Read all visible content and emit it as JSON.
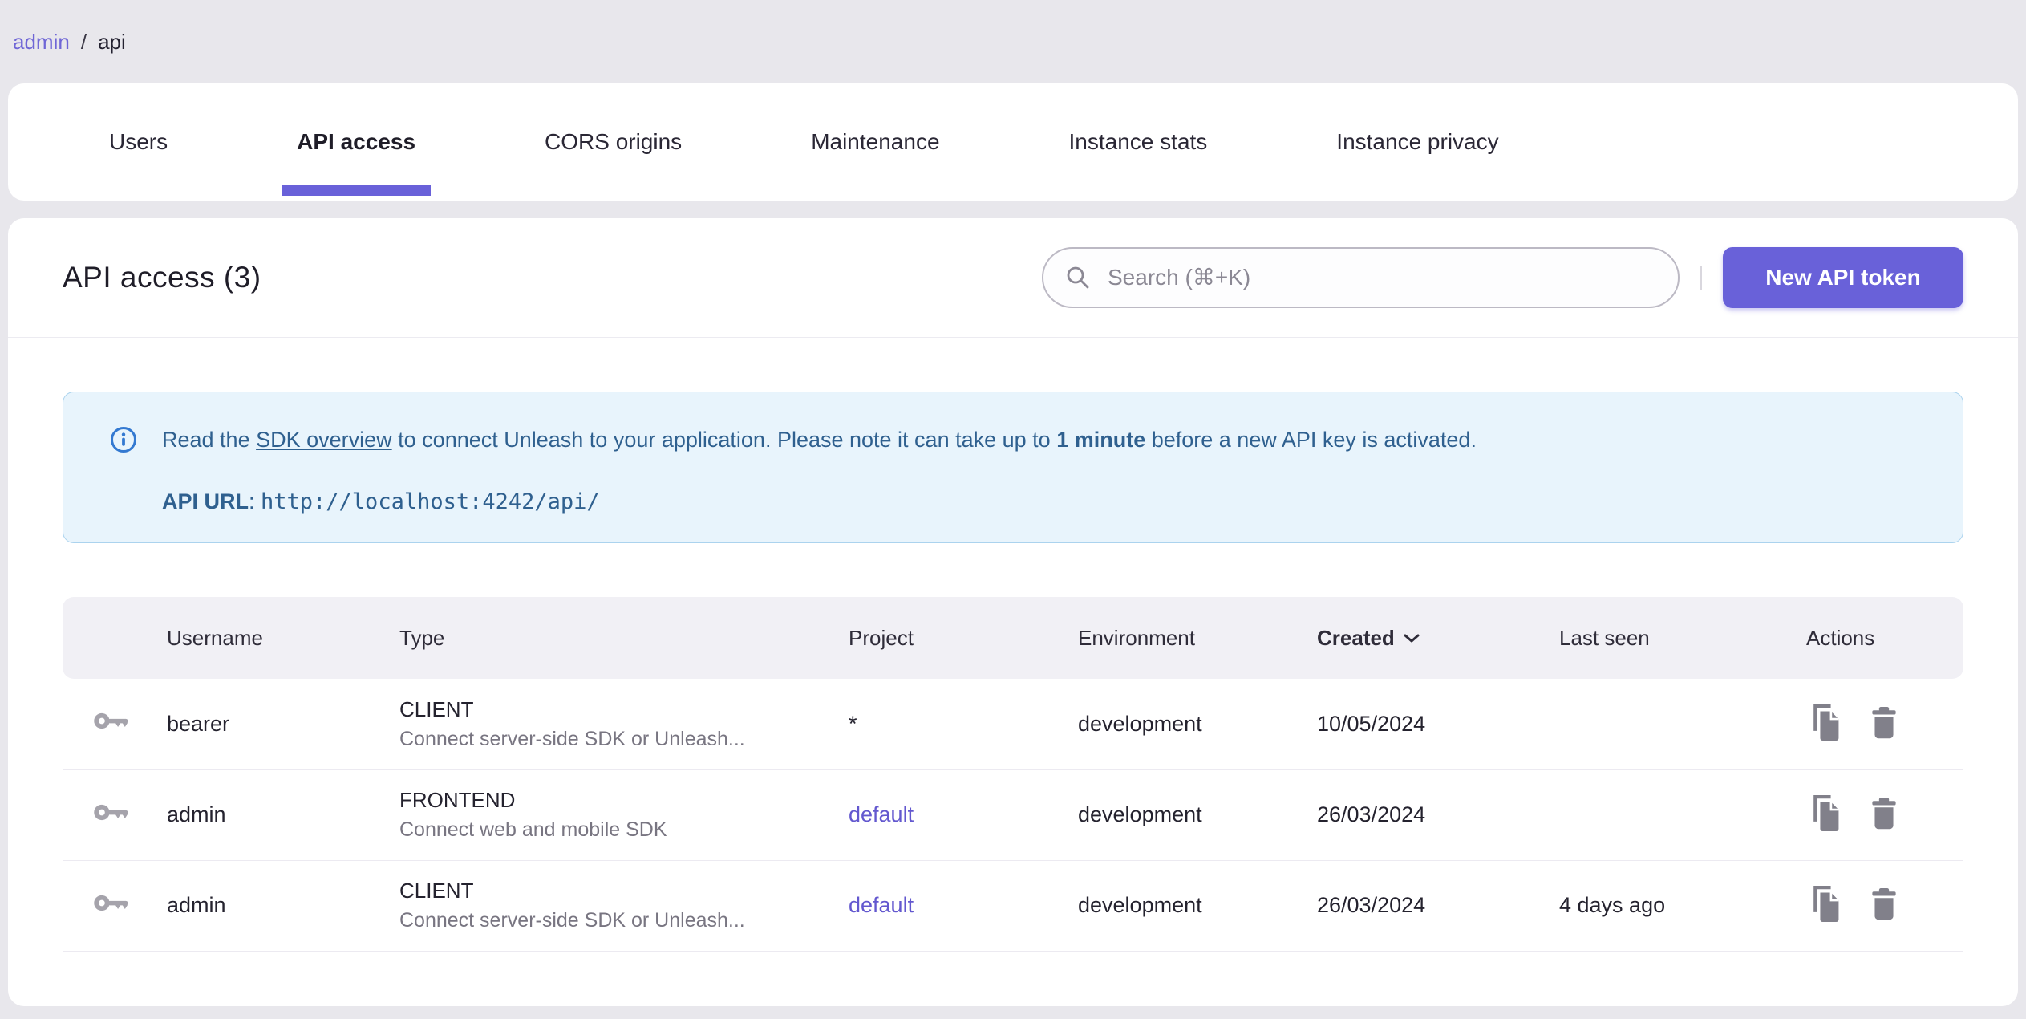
{
  "breadcrumb": {
    "link": "admin",
    "separator": "/",
    "current": "api"
  },
  "tabs": {
    "items": [
      {
        "label": "Users",
        "active": false
      },
      {
        "label": "API access",
        "active": true
      },
      {
        "label": "CORS origins",
        "active": false
      },
      {
        "label": "Maintenance",
        "active": false
      },
      {
        "label": "Instance stats",
        "active": false
      },
      {
        "label": "Instance privacy",
        "active": false
      }
    ]
  },
  "header": {
    "title": "API access (3)",
    "search_placeholder": "Search (⌘+K)",
    "new_token_button": "New API token"
  },
  "banner": {
    "text_pre_link": "Read the ",
    "link_text": "SDK overview",
    "text_mid": " to connect Unleash to your application. Please note it can take up to ",
    "text_bold": "1 minute",
    "text_post": " before a new API key is activated.",
    "api_url_label": "API URL",
    "api_url_separator": ": ",
    "api_url": "http://localhost:4242/api/"
  },
  "table": {
    "columns": [
      "Username",
      "Type",
      "Project",
      "Environment",
      "Created",
      "Last seen",
      "Actions"
    ],
    "sort_column": "Created",
    "sort_direction": "desc",
    "rows": [
      {
        "username": "bearer",
        "type": "CLIENT",
        "type_description": "Connect server-side SDK or Unleash...",
        "project": "*",
        "environment": "development",
        "created": "10/05/2024",
        "last_seen": ""
      },
      {
        "username": "admin",
        "type": "FRONTEND",
        "type_description": "Connect web and mobile SDK",
        "project": "default",
        "environment": "development",
        "created": "26/03/2024",
        "last_seen": ""
      },
      {
        "username": "admin",
        "type": "CLIENT",
        "type_description": "Connect server-side SDK or Unleash...",
        "project": "default",
        "environment": "development",
        "created": "26/03/2024",
        "last_seen": "4 days ago"
      }
    ]
  },
  "icons": {
    "search": "magnifier-icon",
    "info": "info-circle-icon",
    "key": "key-icon",
    "copy": "copy-icon",
    "delete": "trash-icon",
    "sort": "chevron-down-icon"
  },
  "colors": {
    "accent_purple": "#6961d9",
    "project_link": "#6358cf",
    "banner_background": "#e8f4fc",
    "banner_border": "#abd3ee",
    "banner_text": "#2f608f",
    "info_icon_blue": "#3379d1",
    "page_background": "#e8e7ec",
    "table_header_background": "#f1f0f5"
  }
}
